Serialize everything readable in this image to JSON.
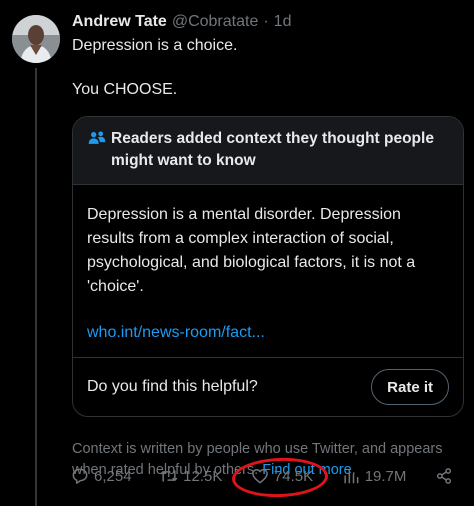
{
  "tweet": {
    "author_name": "Andrew Tate",
    "handle": "@Cobratate",
    "separator": "·",
    "time": "1d",
    "text_line1": "Depression is a choice.",
    "text_line2": "You CHOOSE."
  },
  "community_note": {
    "title": "Readers added context they thought people might want to know",
    "body": "Depression is a mental disorder. Depression results from a complex interaction of social, psychological, and biological factors, it is not a 'choice'.",
    "link": "who.int/news-room/fact...",
    "question": "Do you find this helpful?",
    "rate_label": "Rate it"
  },
  "context_footer": {
    "text": "Context is written by people who use Twitter, and appears when rated helpful by others.",
    "link": "Find out more."
  },
  "actions": {
    "replies": "6,254",
    "retweets": "12.5K",
    "likes": "74.5K",
    "views": "19.7M"
  },
  "colors": {
    "background": "#000000",
    "text": "#e7e9ea",
    "muted": "#71767b",
    "link": "#1d9bf0",
    "annotation": "#e0121a"
  }
}
